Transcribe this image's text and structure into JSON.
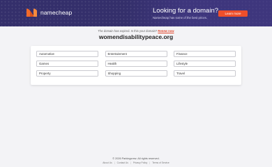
{
  "banner": {
    "brand": "namecheap",
    "promo_title": "Looking for a domain?",
    "promo_subtitle": "Namecheap has some of the best prices.",
    "cta_label": "Learn more",
    "colors": {
      "background": "#342f6b",
      "cta": "#ee4f2b",
      "logo_orange": "#f36b2a"
    }
  },
  "notice": {
    "text": "The domain has expired. Is this your domain?",
    "link_label": "Renew now"
  },
  "domain": "womendisabilitypeace.org",
  "categories": [
    "Automotive",
    "Entertainment",
    "Finance",
    "Games",
    "Health",
    "Lifestyle",
    "Property",
    "Shopping",
    "Travel"
  ],
  "footer": {
    "copyright": "© 2026 Parkingcrew. All rights reserved.",
    "links": [
      "About Us",
      "Contact Us",
      "Privacy Policy",
      "Terms of Service"
    ]
  }
}
